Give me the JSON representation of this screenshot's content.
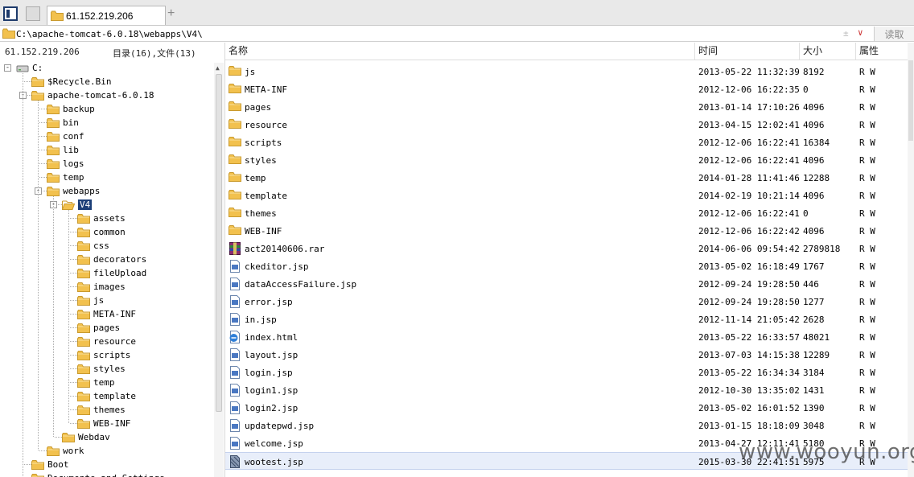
{
  "tabbar": {
    "tab_label": "61.152.219.206",
    "new_tab_label": "+"
  },
  "address": {
    "path": "C:\\apache-tomcat-6.0.18\\webapps\\V4\\",
    "read_button": "读取"
  },
  "info": {
    "host": "61.152.219.206",
    "counts": "目录(16),文件(13)"
  },
  "tree": [
    {
      "label": "C:",
      "level": 0,
      "type": "drive",
      "expand": "-"
    },
    {
      "label": "$Recycle.Bin",
      "level": 1,
      "type": "folder"
    },
    {
      "label": "apache-tomcat-6.0.18",
      "level": 1,
      "type": "folder",
      "expand": "-"
    },
    {
      "label": "backup",
      "level": 2,
      "type": "folder"
    },
    {
      "label": "bin",
      "level": 2,
      "type": "folder"
    },
    {
      "label": "conf",
      "level": 2,
      "type": "folder"
    },
    {
      "label": "lib",
      "level": 2,
      "type": "folder"
    },
    {
      "label": "logs",
      "level": 2,
      "type": "folder"
    },
    {
      "label": "temp",
      "level": 2,
      "type": "folder"
    },
    {
      "label": "webapps",
      "level": 2,
      "type": "folder",
      "expand": "-"
    },
    {
      "label": "V4",
      "level": 3,
      "type": "folder-open",
      "expand": "-",
      "selected": true
    },
    {
      "label": "assets",
      "level": 4,
      "type": "folder"
    },
    {
      "label": "common",
      "level": 4,
      "type": "folder"
    },
    {
      "label": "css",
      "level": 4,
      "type": "folder"
    },
    {
      "label": "decorators",
      "level": 4,
      "type": "folder"
    },
    {
      "label": "fileUpload",
      "level": 4,
      "type": "folder"
    },
    {
      "label": "images",
      "level": 4,
      "type": "folder"
    },
    {
      "label": "js",
      "level": 4,
      "type": "folder"
    },
    {
      "label": "META-INF",
      "level": 4,
      "type": "folder"
    },
    {
      "label": "pages",
      "level": 4,
      "type": "folder"
    },
    {
      "label": "resource",
      "level": 4,
      "type": "folder"
    },
    {
      "label": "scripts",
      "level": 4,
      "type": "folder"
    },
    {
      "label": "styles",
      "level": 4,
      "type": "folder"
    },
    {
      "label": "temp",
      "level": 4,
      "type": "folder"
    },
    {
      "label": "template",
      "level": 4,
      "type": "folder"
    },
    {
      "label": "themes",
      "level": 4,
      "type": "folder"
    },
    {
      "label": "WEB-INF",
      "level": 4,
      "type": "folder"
    },
    {
      "label": "Webdav",
      "level": 3,
      "type": "folder"
    },
    {
      "label": "work",
      "level": 2,
      "type": "folder"
    },
    {
      "label": "Boot",
      "level": 1,
      "type": "folder"
    },
    {
      "label": "Documents and Settings",
      "level": 1,
      "type": "folder"
    }
  ],
  "list": {
    "headers": {
      "name": "名称",
      "time": "时间",
      "size": "大小",
      "attr": "属性"
    },
    "rows": [
      {
        "name": "js",
        "time": "2013-05-22 11:32:39",
        "size": "8192",
        "attr": "R W",
        "type": "folder"
      },
      {
        "name": "META-INF",
        "time": "2012-12-06 16:22:35",
        "size": "0",
        "attr": "R W",
        "type": "folder"
      },
      {
        "name": "pages",
        "time": "2013-01-14 17:10:26",
        "size": "4096",
        "attr": "R W",
        "type": "folder"
      },
      {
        "name": "resource",
        "time": "2013-04-15 12:02:41",
        "size": "4096",
        "attr": "R W",
        "type": "folder"
      },
      {
        "name": "scripts",
        "time": "2012-12-06 16:22:41",
        "size": "16384",
        "attr": "R W",
        "type": "folder"
      },
      {
        "name": "styles",
        "time": "2012-12-06 16:22:41",
        "size": "4096",
        "attr": "R W",
        "type": "folder"
      },
      {
        "name": "temp",
        "time": "2014-01-28 11:41:46",
        "size": "12288",
        "attr": "R W",
        "type": "folder"
      },
      {
        "name": "template",
        "time": "2014-02-19 10:21:14",
        "size": "4096",
        "attr": "R W",
        "type": "folder"
      },
      {
        "name": "themes",
        "time": "2012-12-06 16:22:41",
        "size": "0",
        "attr": "R W",
        "type": "folder"
      },
      {
        "name": "WEB-INF",
        "time": "2012-12-06 16:22:42",
        "size": "4096",
        "attr": "R W",
        "type": "folder"
      },
      {
        "name": "act20140606.rar",
        "time": "2014-06-06 09:54:42",
        "size": "2789818",
        "attr": "R W",
        "type": "archive"
      },
      {
        "name": "ckeditor.jsp",
        "time": "2013-05-02 16:18:49",
        "size": "1767",
        "attr": "R W",
        "type": "file"
      },
      {
        "name": "dataAccessFailure.jsp",
        "time": "2012-09-24 19:28:50",
        "size": "446",
        "attr": "R W",
        "type": "file"
      },
      {
        "name": "error.jsp",
        "time": "2012-09-24 19:28:50",
        "size": "1277",
        "attr": "R W",
        "type": "file"
      },
      {
        "name": "in.jsp",
        "time": "2012-11-14 21:05:42",
        "size": "2628",
        "attr": "R W",
        "type": "file"
      },
      {
        "name": "index.html",
        "time": "2013-05-22 16:33:57",
        "size": "48021",
        "attr": "R W",
        "type": "html"
      },
      {
        "name": "layout.jsp",
        "time": "2013-07-03 14:15:38",
        "size": "12289",
        "attr": "R W",
        "type": "file"
      },
      {
        "name": "login.jsp",
        "time": "2013-05-22 16:34:34",
        "size": "3184",
        "attr": "R W",
        "type": "file"
      },
      {
        "name": "login1.jsp",
        "time": "2012-10-30 13:35:02",
        "size": "1431",
        "attr": "R W",
        "type": "file"
      },
      {
        "name": "login2.jsp",
        "time": "2013-05-02 16:01:52",
        "size": "1390",
        "attr": "R W",
        "type": "file"
      },
      {
        "name": "updatepwd.jsp",
        "time": "2013-01-15 18:18:09",
        "size": "3048",
        "attr": "R W",
        "type": "file"
      },
      {
        "name": "welcome.jsp",
        "time": "2013-04-27 12:11:41",
        "size": "5180",
        "attr": "R W",
        "type": "file"
      },
      {
        "name": "wootest.jsp",
        "time": "2015-03-30 22:41:51",
        "size": "5975",
        "attr": "R W",
        "type": "file-dark",
        "selected": true
      }
    ]
  },
  "watermark": "www.wooyun.org",
  "colors": {
    "folder": "#f2c14e",
    "folder_edge": "#c99a2e",
    "selection": "#1c3f78",
    "row_selection": "#e8eefa"
  }
}
